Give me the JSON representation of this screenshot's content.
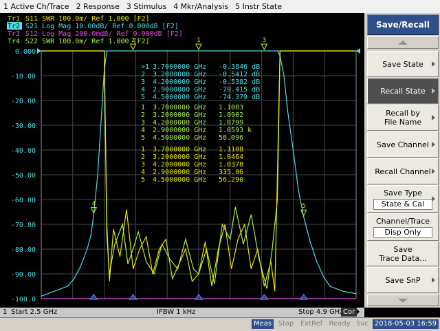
{
  "menu": [
    "1 Active Ch/Trace",
    "2 Response",
    "3 Stimulus",
    "4 Mkr/Analysis",
    "5 Instr State"
  ],
  "traces": [
    {
      "label": "Tr1",
      "text": "S11  SWR 100.0m/ Ref 1.000  [F2]",
      "color": "#e6e600"
    },
    {
      "label": "Tr2",
      "text": "S21  Log Mag 10.00dB/ Ref 0.000dB  [F2]",
      "color": "#4fe0e8",
      "active": true
    },
    {
      "label": "Tr3",
      "text": "S12  Log Mag 200.0mdB/ Ref 0.000dB  [F2]",
      "color": "#e050e0"
    },
    {
      "label": "Tr4",
      "text": "S22  SWR 100.0m/ Ref 1.000  [F2]",
      "color": "#a8f050"
    }
  ],
  "y_axis": {
    "ticks": [
      "0.000",
      "-10.00",
      "-20.00",
      "-30.00",
      "-40.00",
      "-50.00",
      "-60.00",
      "-70.00",
      "-80.00",
      "-90.00",
      "-100.0"
    ],
    "min": -100,
    "max": 0
  },
  "chart_data": {
    "type": "line",
    "title": "",
    "x_start_ghz": 2.5,
    "x_stop_ghz": 4.9,
    "ylim": [
      -100,
      0
    ],
    "series": [
      {
        "name": "S21",
        "color": "#4fe0e8",
        "x": [
          2.5,
          2.6,
          2.7,
          2.75,
          2.8,
          2.85,
          2.88,
          2.9,
          2.93,
          2.96,
          2.98,
          3.0,
          3.02,
          3.1,
          3.3,
          3.7,
          4.1,
          4.25,
          4.3,
          4.32,
          4.35,
          4.38,
          4.42,
          4.46,
          4.5,
          4.55,
          4.6,
          4.65,
          4.7,
          4.8,
          4.9
        ],
        "y": [
          -99,
          -97,
          -95,
          -92,
          -87,
          -80,
          -74,
          -66,
          -50,
          -25,
          -8,
          0,
          0,
          0,
          0,
          0,
          0,
          0,
          0,
          -2,
          -10,
          -25,
          -40,
          -56,
          -67,
          -77,
          -85,
          -91,
          -95,
          -97,
          -98
        ]
      },
      {
        "name": "S11",
        "color": "#e6e600",
        "x": [
          2.5,
          2.85,
          2.98,
          3.0,
          3.02,
          3.05,
          3.1,
          3.15,
          3.2,
          3.25,
          3.3,
          3.35,
          3.4,
          3.45,
          3.5,
          3.55,
          3.6,
          3.65,
          3.7,
          3.75,
          3.8,
          3.85,
          3.9,
          3.95,
          4.0,
          4.05,
          4.1,
          4.15,
          4.2,
          4.25,
          4.28,
          4.3,
          4.32,
          4.9
        ],
        "y": [
          0,
          0,
          0,
          -70,
          -93,
          -72,
          -83,
          -64,
          -88,
          -80,
          -75,
          -90,
          -80,
          -76,
          -92,
          -86,
          -80,
          -93,
          -90,
          -77,
          -95,
          -80,
          -70,
          -88,
          -76,
          -70,
          -88,
          -80,
          -95,
          -85,
          -97,
          -50,
          0,
          0
        ]
      },
      {
        "name": "S22",
        "color": "#a8f050",
        "x": [
          2.5,
          2.86,
          2.98,
          3.0,
          3.02,
          3.06,
          3.12,
          3.16,
          3.2,
          3.24,
          3.3,
          3.36,
          3.42,
          3.48,
          3.54,
          3.6,
          3.66,
          3.7,
          3.76,
          3.82,
          3.88,
          3.94,
          3.98,
          4.04,
          4.1,
          4.16,
          4.22,
          4.26,
          4.3,
          4.32,
          4.9
        ],
        "y": [
          0,
          0,
          0,
          -75,
          -90,
          -78,
          -70,
          -86,
          -80,
          -73,
          -85,
          -90,
          -78,
          -84,
          -88,
          -76,
          -88,
          -90,
          -80,
          -94,
          -70,
          -76,
          -63,
          -78,
          -66,
          -84,
          -96,
          -80,
          -60,
          0,
          0
        ]
      },
      {
        "name": "S12",
        "color": "#e050e0",
        "x": [
          2.5,
          4.9
        ],
        "y": [
          -100,
          -100
        ]
      }
    ],
    "markers": [
      {
        "n": "1",
        "freq": "3.7000000 GHz"
      },
      {
        "n": "2",
        "freq": "3.2000000 GHz"
      },
      {
        "n": "3",
        "freq": "4.2000000 GHz"
      },
      {
        "n": "4",
        "freq": "2.9000000 GHz"
      },
      {
        "n": "5",
        "freq": "4.5000000 GHz"
      }
    ]
  },
  "marker_tables": [
    {
      "color": "#4fe0e8",
      "rows": [
        {
          "idx": ">1",
          "freq": "3.7000000 GHz",
          "val": "-0.3846 dB"
        },
        {
          "idx": "2",
          "freq": "3.2000000 GHz",
          "val": "-0.5412 dB"
        },
        {
          "idx": "3",
          "freq": "4.2000000 GHz",
          "val": "-0.5382 dB"
        },
        {
          "idx": "4",
          "freq": "2.9000000 GHz",
          "val": "-79.415 dB"
        },
        {
          "idx": "5",
          "freq": "4.5000000 GHz",
          "val": "-74.379 dB"
        }
      ]
    },
    {
      "color": "#a8f050",
      "rows": [
        {
          "idx": "1",
          "freq": "3.7000000 GHz",
          "val": "1.1003"
        },
        {
          "idx": "2",
          "freq": "3.2000000 GHz",
          "val": "1.0902"
        },
        {
          "idx": "3",
          "freq": "4.2000000 GHz",
          "val": "1.0799"
        },
        {
          "idx": "4",
          "freq": "2.9000000 GHz",
          "val": "1.0593 k"
        },
        {
          "idx": "5",
          "freq": "4.5000000 GHz",
          "val": "58.096"
        }
      ]
    },
    {
      "color": "#e6e600",
      "rows": [
        {
          "idx": "1",
          "freq": "3.7000000 GHz",
          "val": "1.1108"
        },
        {
          "idx": "2",
          "freq": "3.2000000 GHz",
          "val": "1.0464"
        },
        {
          "idx": "3",
          "freq": "4.2000000 GHz",
          "val": "1.0378"
        },
        {
          "idx": "4",
          "freq": "2.9000000 GHz",
          "val": "335.06"
        },
        {
          "idx": "5",
          "freq": "4.5000000 GHz",
          "val": "56.290"
        }
      ]
    }
  ],
  "status_row": {
    "channel": "1",
    "start": "Start 2.5 GHz",
    "ifbw": "IFBW 1 kHz",
    "stop": "Stop 4.9 GHz",
    "cor": "Cor"
  },
  "softkeys": {
    "title": "Save/Recall",
    "save_state": "Save State",
    "recall_state": "Recall State",
    "recall_by_line1": "Recall by",
    "recall_by_line2": "File Name",
    "save_channel": "Save Channel",
    "recall_channel": "Recall Channel",
    "save_type": "Save Type",
    "save_type_value": "State & Cal",
    "channel_trace": "Channel/Trace",
    "channel_trace_value": "Disp Only",
    "save_trace_line1": "Save",
    "save_trace_line2": "Trace Data...",
    "save_snp": "Save SnP"
  },
  "bottom_status": {
    "meas": "Meas",
    "stop": "Stop",
    "extref": "ExtRef",
    "ready": "Ready",
    "svc": "Svc",
    "datetime": "2018-05-03 16:59"
  }
}
